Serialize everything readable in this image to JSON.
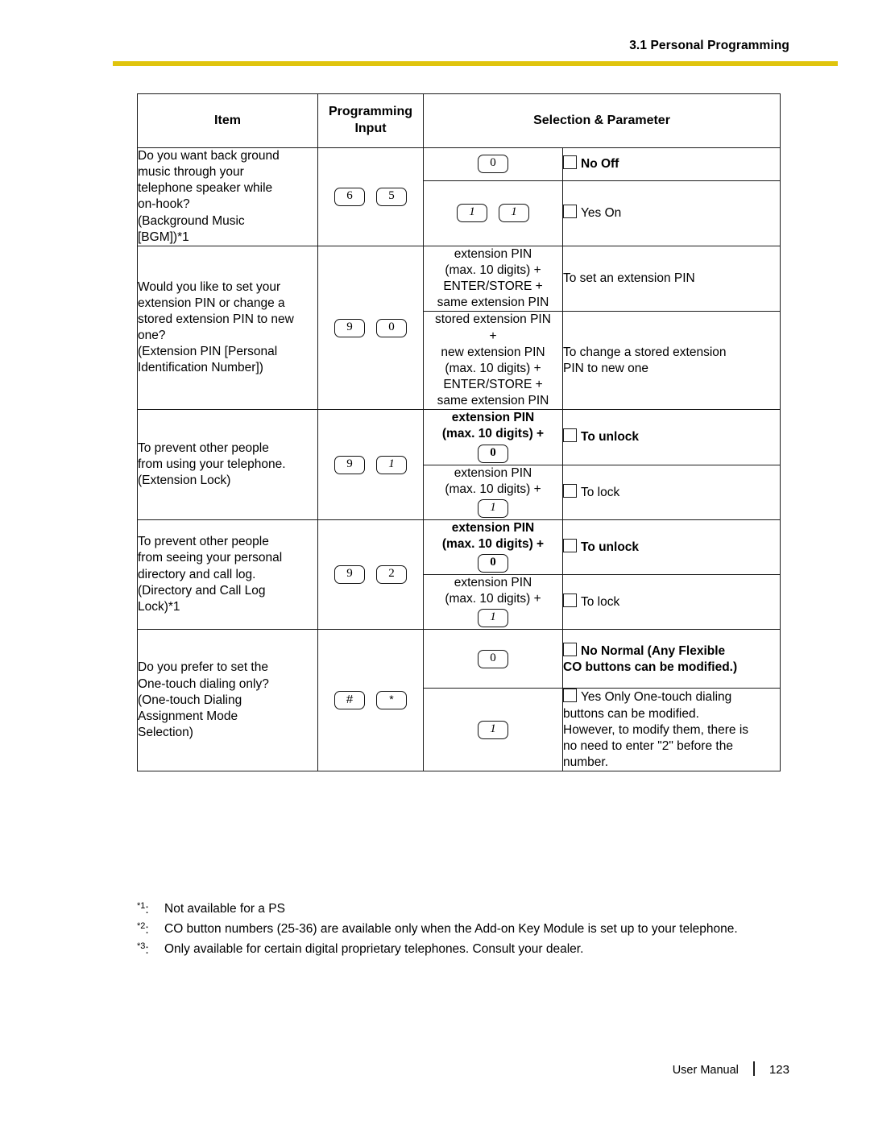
{
  "header": {
    "section": "3.1 Personal Programming",
    "rule_color": "#E0C40D"
  },
  "table": {
    "columns": [
      "Item",
      "Programming Input",
      "Selection & Parameter"
    ],
    "headers": {
      "item": "Item",
      "programming_input_line1": "Programming",
      "programming_input_line2": "Input",
      "selection_parameter": "Selection & Parameter"
    },
    "rows": [
      {
        "item_lines": [
          "Do you want back ground",
          "music through your",
          "telephone speaker while",
          "on-hook?",
          "(Background Music",
          "[BGM])*1"
        ],
        "input_keys": [
          "6",
          "5"
        ],
        "options": [
          {
            "selection_keys": [
              "0"
            ],
            "selection_text": "",
            "selection_bold": false,
            "parameter": "No   Off",
            "parameter_bold": true,
            "checkbox": true
          },
          {
            "selection_keys": [
              "1",
              "1"
            ],
            "selection_text": "",
            "selection_bold": false,
            "parameter": "Yes   On",
            "parameter_bold": false,
            "checkbox": true
          }
        ]
      },
      {
        "item_lines": [
          "Would you like to set your",
          "extension PIN or change a",
          "stored extension PIN to new",
          "one?",
          "(Extension PIN [Personal",
          "Identification Number])"
        ],
        "input_keys": [
          "9",
          "0"
        ],
        "options": [
          {
            "selection_lines": [
              "extension PIN",
              "(max. 10 digits) +",
              "ENTER/STORE +",
              "same extension PIN"
            ],
            "selection_bold": false,
            "parameter": "To set an extension PIN",
            "parameter_bold": false,
            "checkbox": false
          },
          {
            "selection_lines": [
              "stored extension PIN",
              "+",
              "new extension PIN",
              "(max. 10 digits) +",
              "ENTER/STORE +",
              "same extension PIN"
            ],
            "selection_bold": false,
            "parameter_lines": [
              "To change a stored extension",
              "PIN to new one"
            ],
            "parameter_bold": false,
            "checkbox": false
          }
        ]
      },
      {
        "item_lines": [
          "To prevent other people",
          "from using your telephone.",
          "(Extension Lock)"
        ],
        "input_keys": [
          "9",
          "1"
        ],
        "options": [
          {
            "selection_lines": [
              "extension PIN",
              "(max. 10 digits) +"
            ],
            "selection_keys": [
              "0"
            ],
            "selection_bold": true,
            "parameter": "To unlock",
            "parameter_bold": true,
            "checkbox": true
          },
          {
            "selection_lines": [
              "extension PIN",
              "(max. 10 digits) +"
            ],
            "selection_keys": [
              "1"
            ],
            "selection_bold": false,
            "parameter": "To lock",
            "parameter_bold": false,
            "checkbox": true
          }
        ]
      },
      {
        "item_lines": [
          "To prevent other people",
          "from seeing your personal",
          "directory and call log.",
          "(Directory and Call Log",
          "Lock)*1"
        ],
        "input_keys": [
          "9",
          "2"
        ],
        "options": [
          {
            "selection_lines": [
              "extension PIN",
              "(max. 10 digits) +"
            ],
            "selection_keys": [
              "0"
            ],
            "selection_bold": true,
            "parameter": "To unlock",
            "parameter_bold": true,
            "checkbox": true
          },
          {
            "selection_lines": [
              "extension PIN",
              "(max. 10 digits) +"
            ],
            "selection_keys": [
              "1"
            ],
            "selection_bold": false,
            "parameter": "To lock",
            "parameter_bold": false,
            "checkbox": true
          }
        ]
      },
      {
        "item_lines": [
          "Do you prefer to set the",
          "One-touch dialing only?",
          "(One-touch Dialing",
          "Assignment Mode",
          "Selection)"
        ],
        "input_keys": [
          "#",
          "*"
        ],
        "options": [
          {
            "selection_keys": [
              "0"
            ],
            "selection_bold": false,
            "parameter_lines": [
              "No    Normal (Any Flexible",
              "CO buttons can be modified.)"
            ],
            "parameter_bold": true,
            "checkbox": true
          },
          {
            "selection_keys": [
              "1"
            ],
            "selection_bold": false,
            "parameter_lines": [
              "Yes    Only One-touch dialing",
              "buttons can be modified.",
              "However, to modify them, there is",
              "no need to enter \"2\" before the",
              "number."
            ],
            "parameter_bold": false,
            "checkbox": true
          }
        ]
      }
    ]
  },
  "footnotes": [
    {
      "mark": "*1",
      "text": "Not available for a PS"
    },
    {
      "mark": "*2",
      "text": "CO button numbers (25-36) are available only when the Add-on Key Module is set up to your telephone."
    },
    {
      "mark": "*3",
      "text": "Only available for certain digital proprietary telephones. Consult your dealer."
    }
  ],
  "footer": {
    "label": "User Manual",
    "page_number": "123"
  }
}
